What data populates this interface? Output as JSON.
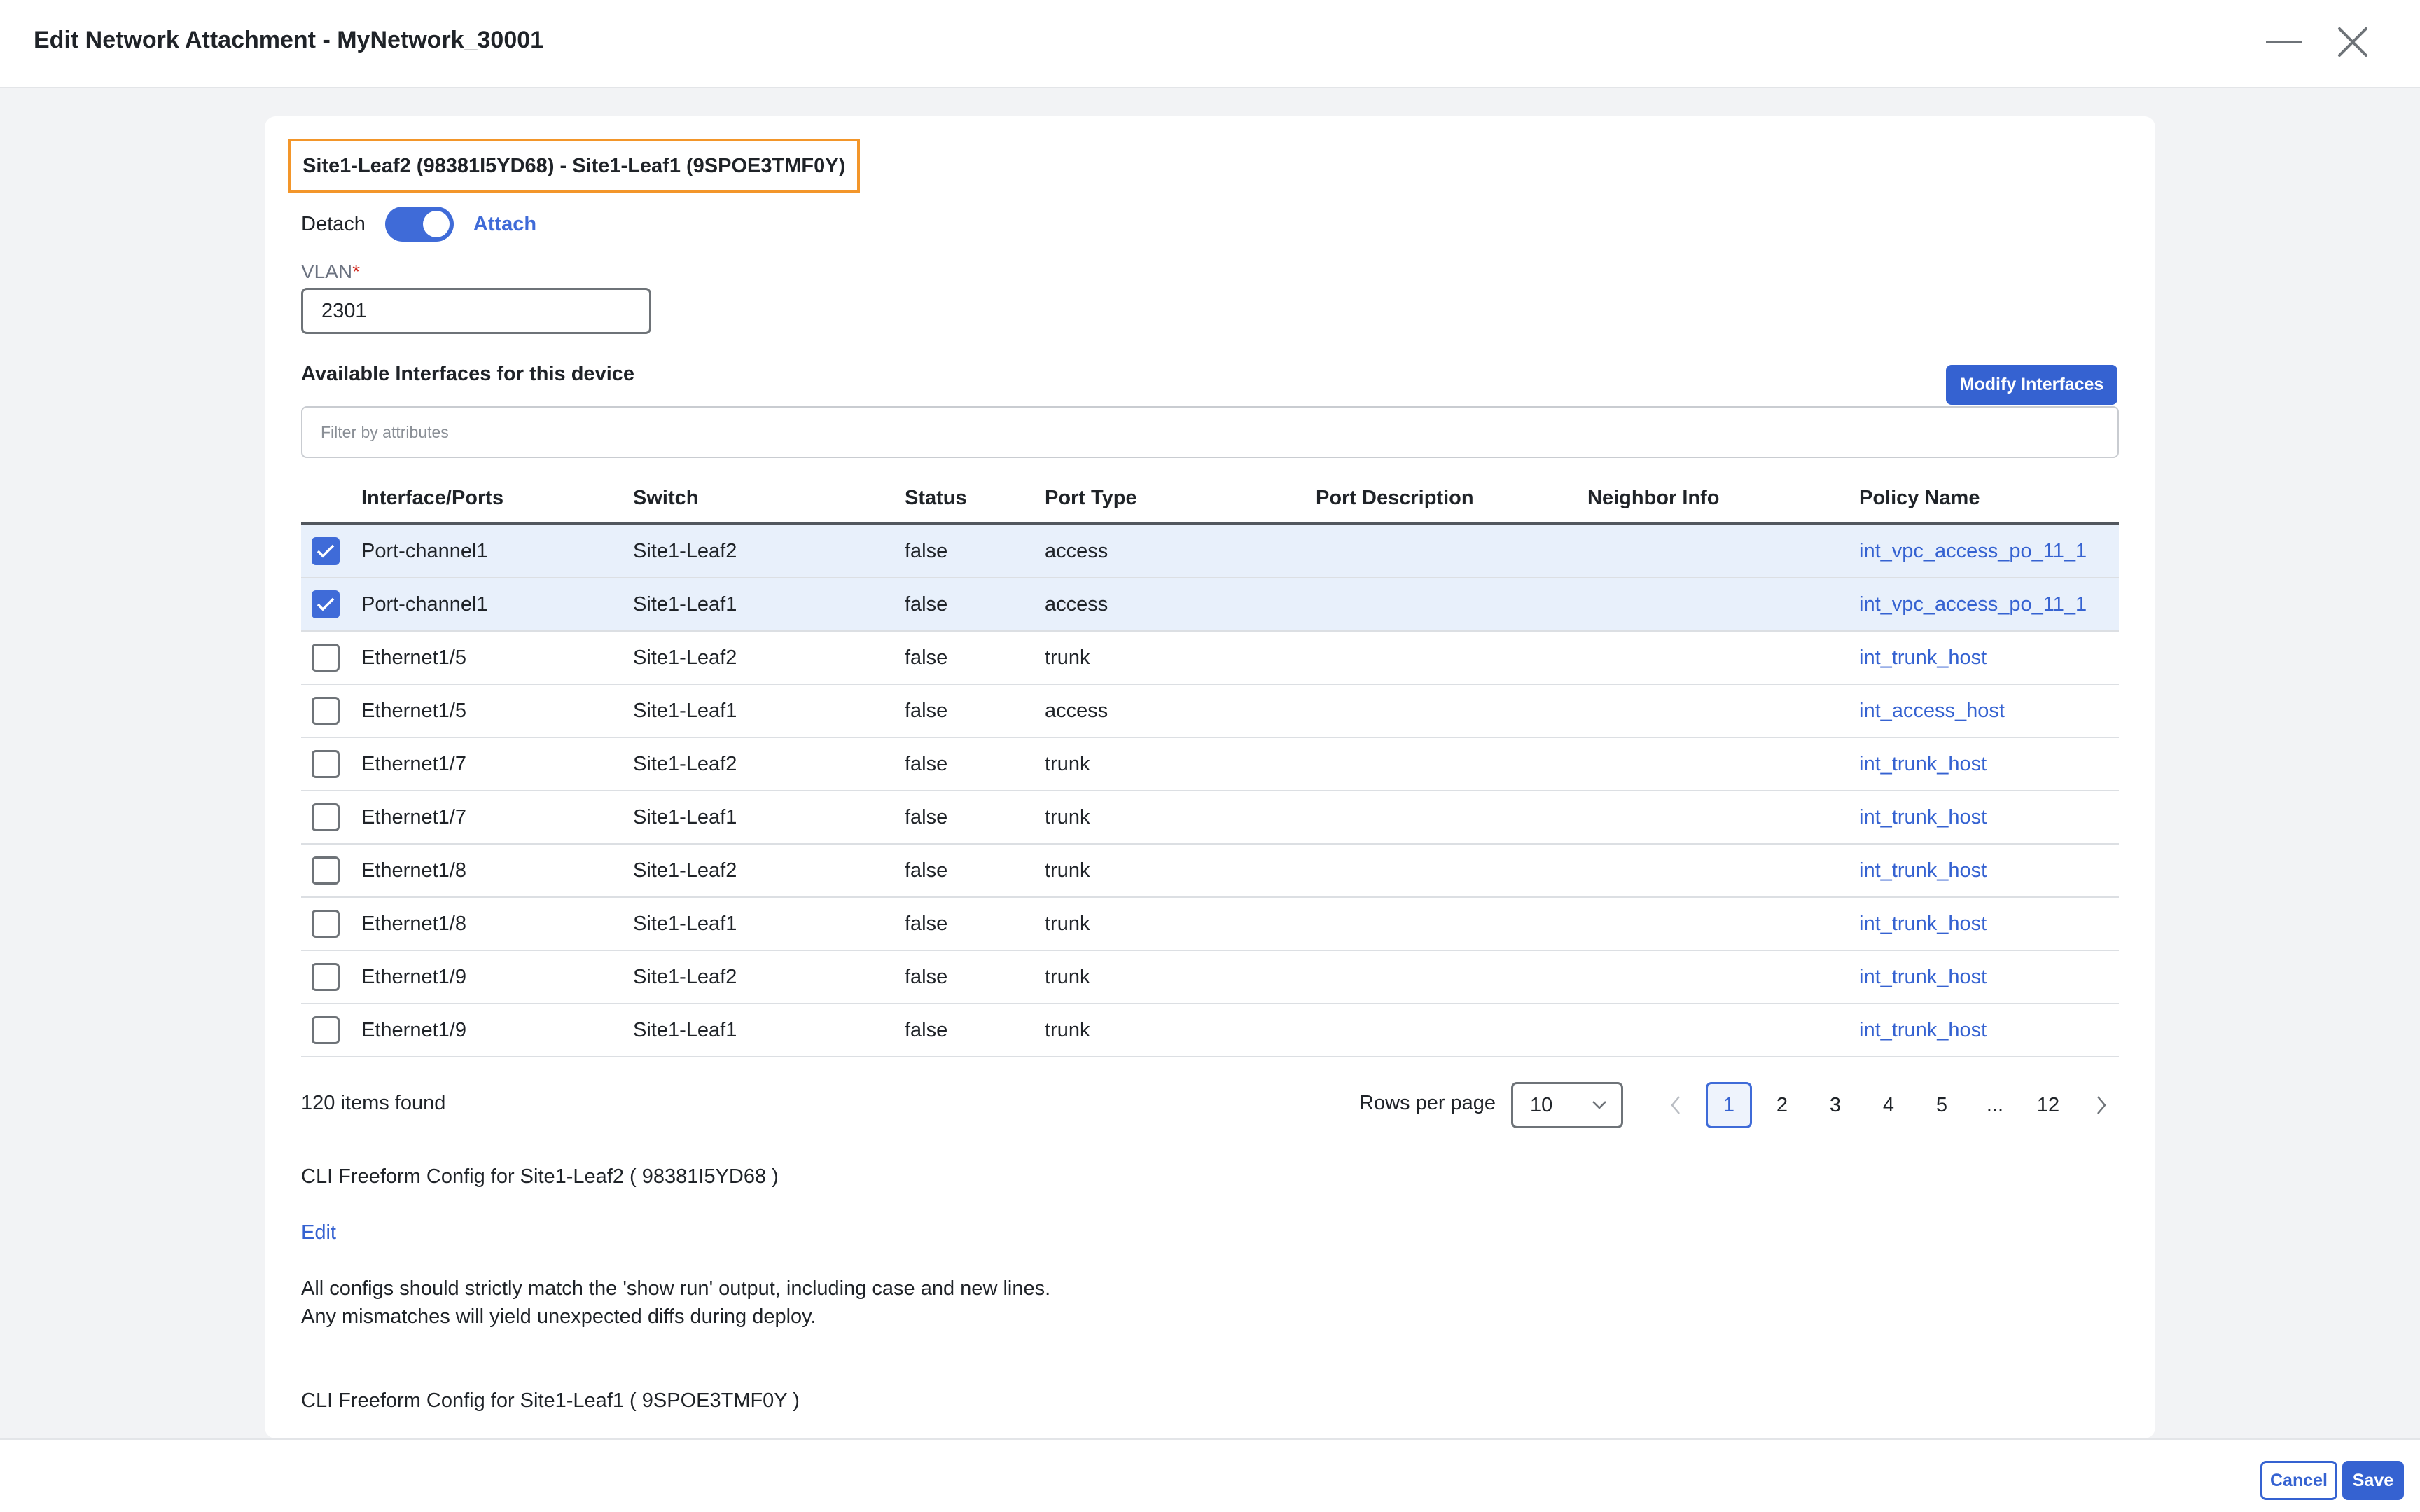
{
  "dialog": {
    "title": "Edit Network Attachment - MyNetwork_30001"
  },
  "device": {
    "title": "Site1-Leaf2 (98381I5YD68) - Site1-Leaf1 (9SPOE3TMF0Y)",
    "detach_label": "Detach",
    "attach_label": "Attach",
    "attached": true
  },
  "vlan": {
    "label": "VLAN",
    "required_mark": "*",
    "value": "2301"
  },
  "interfaces": {
    "title": "Available Interfaces for this device",
    "modify_button": "Modify Interfaces",
    "filter_placeholder": "Filter by attributes",
    "columns": [
      "Interface/Ports",
      "Switch",
      "Status",
      "Port Type",
      "Port Description",
      "Neighbor Info",
      "Policy Name"
    ],
    "rows": [
      {
        "checked": true,
        "interface": "Port-channel1",
        "switch": "Site1-Leaf2",
        "status": "false",
        "port_type": "access",
        "port_description": "",
        "neighbor_info": "",
        "policy": "int_vpc_access_po_11_1"
      },
      {
        "checked": true,
        "interface": "Port-channel1",
        "switch": "Site1-Leaf1",
        "status": "false",
        "port_type": "access",
        "port_description": "",
        "neighbor_info": "",
        "policy": "int_vpc_access_po_11_1"
      },
      {
        "checked": false,
        "interface": "Ethernet1/5",
        "switch": "Site1-Leaf2",
        "status": "false",
        "port_type": "trunk",
        "port_description": "",
        "neighbor_info": "",
        "policy": "int_trunk_host"
      },
      {
        "checked": false,
        "interface": "Ethernet1/5",
        "switch": "Site1-Leaf1",
        "status": "false",
        "port_type": "access",
        "port_description": "",
        "neighbor_info": "",
        "policy": "int_access_host"
      },
      {
        "checked": false,
        "interface": "Ethernet1/7",
        "switch": "Site1-Leaf2",
        "status": "false",
        "port_type": "trunk",
        "port_description": "",
        "neighbor_info": "",
        "policy": "int_trunk_host"
      },
      {
        "checked": false,
        "interface": "Ethernet1/7",
        "switch": "Site1-Leaf1",
        "status": "false",
        "port_type": "trunk",
        "port_description": "",
        "neighbor_info": "",
        "policy": "int_trunk_host"
      },
      {
        "checked": false,
        "interface": "Ethernet1/8",
        "switch": "Site1-Leaf2",
        "status": "false",
        "port_type": "trunk",
        "port_description": "",
        "neighbor_info": "",
        "policy": "int_trunk_host"
      },
      {
        "checked": false,
        "interface": "Ethernet1/8",
        "switch": "Site1-Leaf1",
        "status": "false",
        "port_type": "trunk",
        "port_description": "",
        "neighbor_info": "",
        "policy": "int_trunk_host"
      },
      {
        "checked": false,
        "interface": "Ethernet1/9",
        "switch": "Site1-Leaf2",
        "status": "false",
        "port_type": "trunk",
        "port_description": "",
        "neighbor_info": "",
        "policy": "int_trunk_host"
      },
      {
        "checked": false,
        "interface": "Ethernet1/9",
        "switch": "Site1-Leaf1",
        "status": "false",
        "port_type": "trunk",
        "port_description": "",
        "neighbor_info": "",
        "policy": "int_trunk_host"
      }
    ]
  },
  "pagination": {
    "items_found": "120 items found",
    "rows_per_page_label": "Rows per page",
    "rows_per_page_value": "10",
    "pages": [
      "1",
      "2",
      "3",
      "4",
      "5",
      "...",
      "12"
    ],
    "current_page": "1"
  },
  "cli": {
    "leaf2_title": "CLI Freeform Config for Site1-Leaf2 ( 98381I5YD68 )",
    "edit_label": "Edit",
    "note_line1": "All configs should strictly match the 'show run' output, including case and new lines.",
    "note_line2": "Any mismatches will yield unexpected diffs during deploy.",
    "leaf1_title": "CLI Freeform Config for Site1-Leaf1 ( 9SPOE3TMF0Y )"
  },
  "footer": {
    "cancel_label": "Cancel",
    "save_label": "Save"
  },
  "colors": {
    "accent": "#3562d1",
    "highlight_border": "#f3962a",
    "selected_row": "#e8f0fb"
  },
  "icons": {
    "minimize": "minimize-icon",
    "close": "close-icon",
    "check": "check-icon",
    "chevron_down": "chevron-down-icon",
    "chevron_left": "chevron-left-icon",
    "chevron_right": "chevron-right-icon"
  }
}
